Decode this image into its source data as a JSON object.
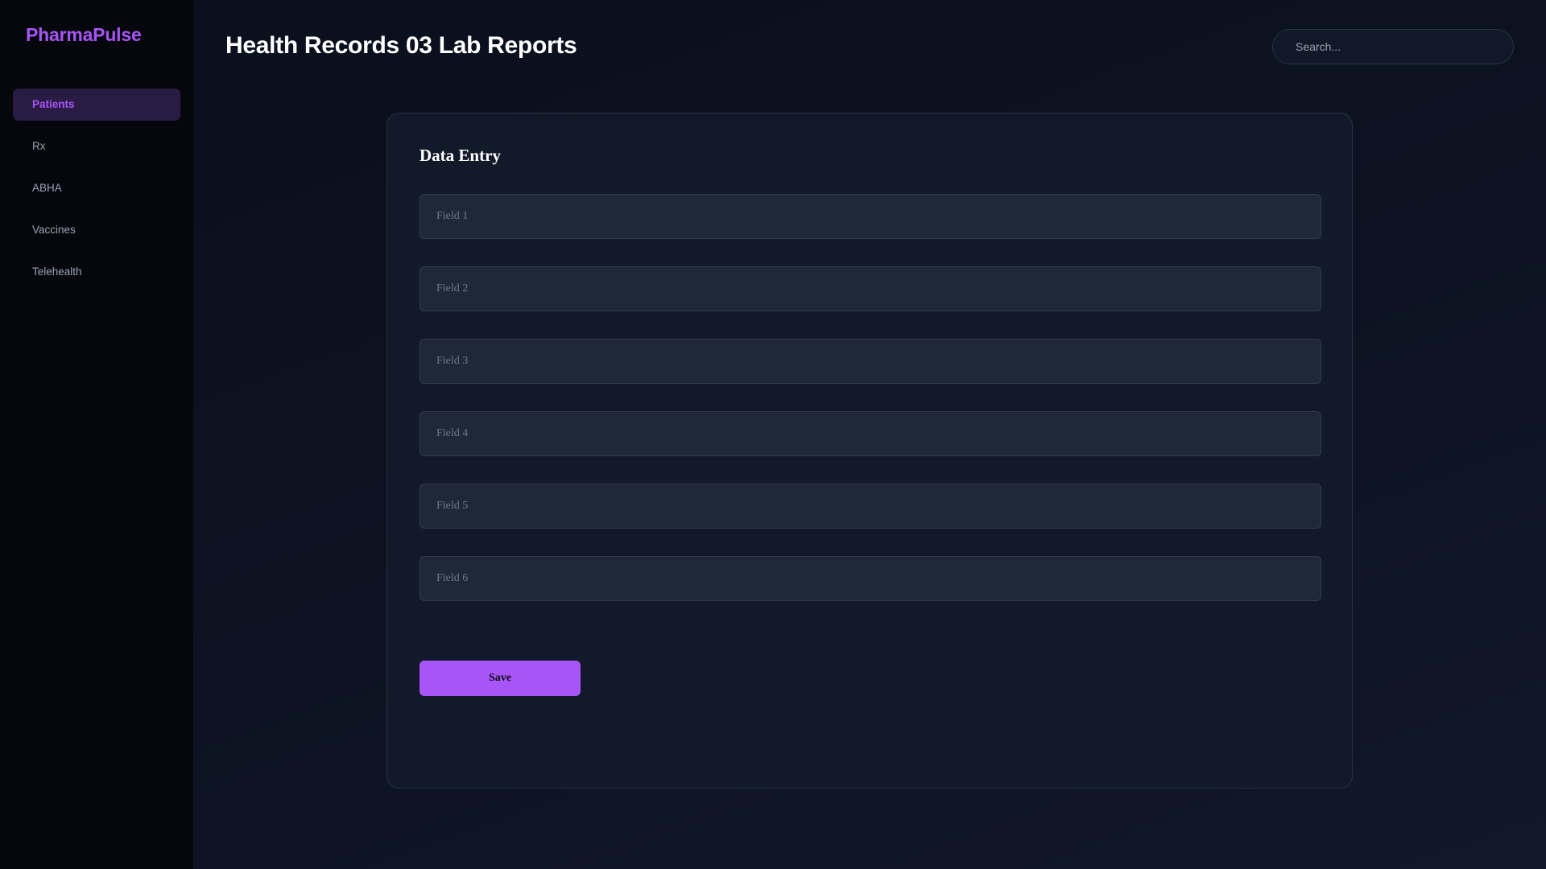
{
  "app": {
    "brand": "PharmaPulse"
  },
  "sidebar": {
    "items": [
      {
        "label": "Patients",
        "active": true
      },
      {
        "label": "Rx",
        "active": false
      },
      {
        "label": "ABHA",
        "active": false
      },
      {
        "label": "Vaccines",
        "active": false
      },
      {
        "label": "Telehealth",
        "active": false
      }
    ]
  },
  "header": {
    "title": "Health Records 03 Lab Reports",
    "search_placeholder": "Search...",
    "search_value": ""
  },
  "form": {
    "title": "Data Entry",
    "fields": [
      {
        "placeholder": "Field 1",
        "value": ""
      },
      {
        "placeholder": "Field 2",
        "value": ""
      },
      {
        "placeholder": "Field 3",
        "value": ""
      },
      {
        "placeholder": "Field 4",
        "value": ""
      },
      {
        "placeholder": "Field 5",
        "value": ""
      },
      {
        "placeholder": "Field 6",
        "value": ""
      }
    ],
    "save_label": "Save"
  },
  "colors": {
    "accent": "#a855f7",
    "sidebar_bg": "#05070c",
    "active_nav_bg": "#2a1b45",
    "card_bg": "#121a29",
    "input_bg": "#1f2837"
  }
}
